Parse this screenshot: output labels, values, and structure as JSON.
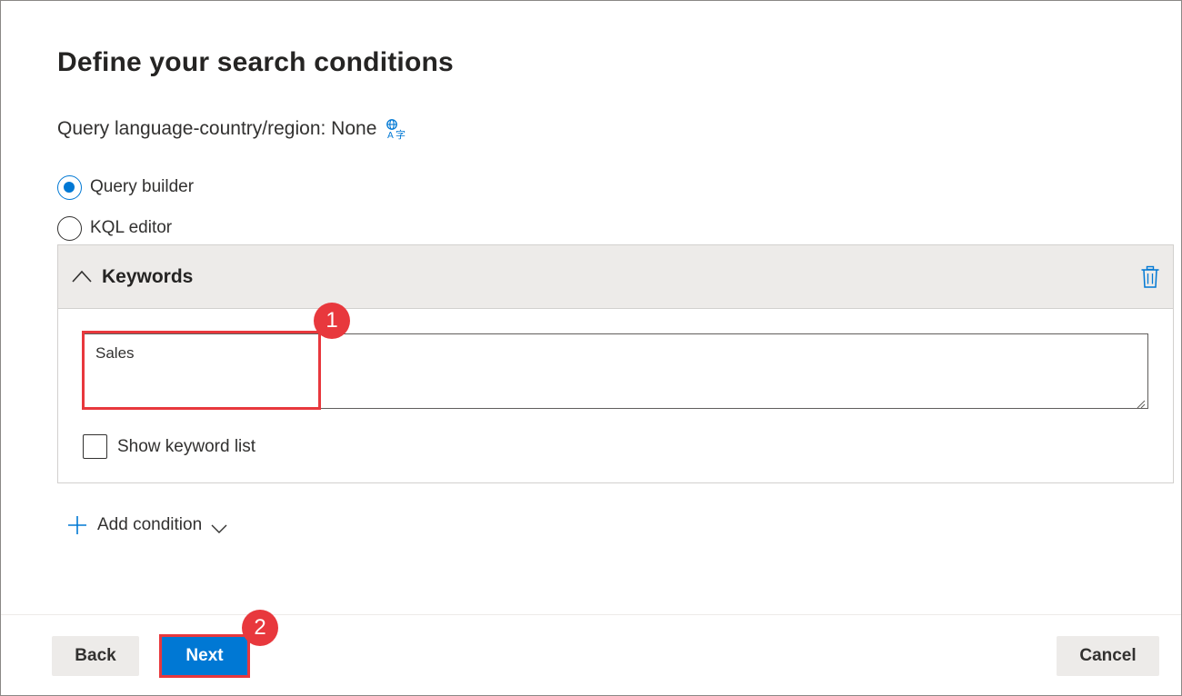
{
  "page": {
    "title": "Define your search conditions",
    "language_label": "Query language-country/region: None"
  },
  "icons": {
    "language": "translate-icon",
    "collapse": "chevron-up-icon",
    "delete": "trash-icon",
    "add": "plus-icon",
    "expand": "chevron-down-icon"
  },
  "query_mode": {
    "options": [
      {
        "label": "Query builder",
        "selected": true
      },
      {
        "label": "KQL editor",
        "selected": false
      }
    ]
  },
  "keywords_panel": {
    "title": "Keywords",
    "value": "Sales",
    "show_keyword_list_label": "Show keyword list",
    "show_keyword_list_checked": false
  },
  "add_condition_label": "Add condition",
  "annotations": {
    "step1": "1",
    "step2": "2",
    "color": "#e8383d"
  },
  "footer": {
    "back_label": "Back",
    "next_label": "Next",
    "cancel_label": "Cancel"
  },
  "colors": {
    "accent": "#0078d4",
    "header_bg": "#edebe9"
  }
}
